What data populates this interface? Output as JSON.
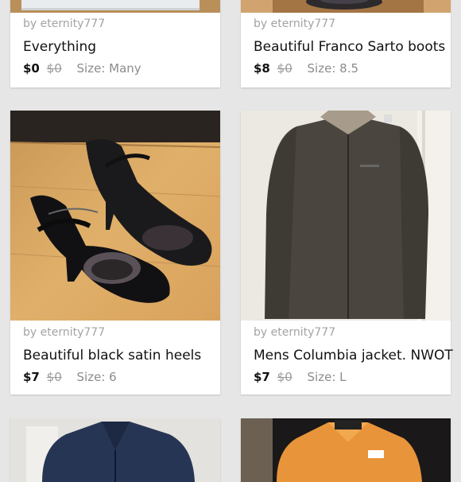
{
  "listings": [
    {
      "seller": "by eternity777",
      "title": "Everything",
      "price": "$0",
      "original_price": "$0",
      "size_label": "Size: Many"
    },
    {
      "seller": "by eternity777",
      "title": "Beautiful Franco Sarto boots",
      "price": "$8",
      "original_price": "$0",
      "size_label": "Size: 8.5"
    },
    {
      "seller": "by eternity777",
      "title": "Beautiful black satin heels",
      "price": "$7",
      "original_price": "$0",
      "size_label": "Size: 6"
    },
    {
      "seller": "by eternity777",
      "title": "Mens Columbia jacket. NWOT",
      "price": "$7",
      "original_price": "$0",
      "size_label": "Size: L"
    }
  ]
}
